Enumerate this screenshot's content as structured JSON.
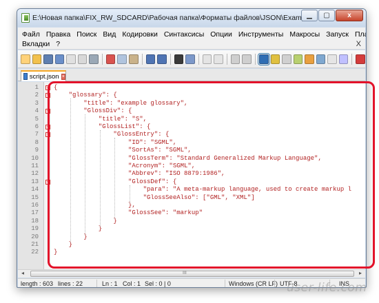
{
  "window": {
    "title": "E:\\Новая папка\\FIX_RW_SDCARD\\Рабочая папка\\Форматы файлов\\JSON\\Example\\script.json - Notepad+...",
    "minimize_icon": "minimize-icon",
    "maximize_icon": "maximize-icon",
    "close_label": "x"
  },
  "menu": {
    "row1": [
      "Файл",
      "Правка",
      "Поиск",
      "Вид",
      "Кодировки",
      "Синтаксисы",
      "Опции",
      "Инструменты",
      "Макросы",
      "Запуск",
      "Плагины"
    ],
    "row2": [
      "Вкладки",
      "?"
    ],
    "close_label": "X"
  },
  "toolbar": {
    "buttons": [
      "new-file-icon",
      "open-file-icon",
      "save-icon",
      "save-all-icon",
      "close-icon",
      "close-all-icon",
      "print-icon",
      "cut-icon",
      "copy-icon",
      "paste-icon",
      "undo-icon",
      "redo-icon",
      "find-icon",
      "replace-icon",
      "zoom-in-icon",
      "zoom-out-icon",
      "sync-vertical-icon",
      "sync-horizontal-icon",
      "word-wrap-icon",
      "show-all-chars-icon",
      "indent-guide-icon",
      "user-lang-icon",
      "function-list-icon",
      "folder-workspace-icon",
      "doc-map-icon",
      "monitoring-icon",
      "record-macro-icon"
    ]
  },
  "tab": {
    "label": "script.json",
    "icon": "file-icon"
  },
  "editor": {
    "line_numbers": [
      "1",
      "2",
      "3",
      "4",
      "5",
      "6",
      "7",
      "8",
      "9",
      "10",
      "11",
      "12",
      "13",
      "14",
      "15",
      "16",
      "17",
      "18",
      "19",
      "20",
      "21",
      "22"
    ],
    "lines": [
      "{",
      "    \"glossary\": {",
      "        \"title\": \"example glossary\",",
      "        \"GlossDiv\": {",
      "            \"title\": \"S\",",
      "            \"GlossList\": {",
      "                \"GlossEntry\": {",
      "                    \"ID\": \"SGML\",",
      "                    \"SortAs\": \"SGML\",",
      "                    \"GlossTerm\": \"Standard Generalized Markup Language\",",
      "                    \"Acronym\": \"SGML\",",
      "                    \"Abbrev\": \"ISO 8879:1986\",",
      "                    \"GlossDef\": {",
      "                        \"para\": \"A meta-markup language, used to create markup l",
      "                        \"GlossSeeAlso\": [\"GML\", \"XML\"]",
      "                    },",
      "                    \"GlossSee\": \"markup\"",
      "                }",
      "            }",
      "        }",
      "    }",
      "}"
    ]
  },
  "scrollbar": {
    "grip_label": "III"
  },
  "status": {
    "length": "length : 603",
    "lines": "lines : 22",
    "ln": "Ln : 1",
    "col": "Col : 1",
    "sel": "Sel : 0 | 0",
    "eol": "Windows (CR LF)",
    "encoding": "UTF-8",
    "mode": "INS"
  },
  "watermark": "user-life.com",
  "colors": {
    "code_text": "#b22222",
    "highlight_frame": "#e3122a",
    "fold_marker": "#d2322d"
  }
}
